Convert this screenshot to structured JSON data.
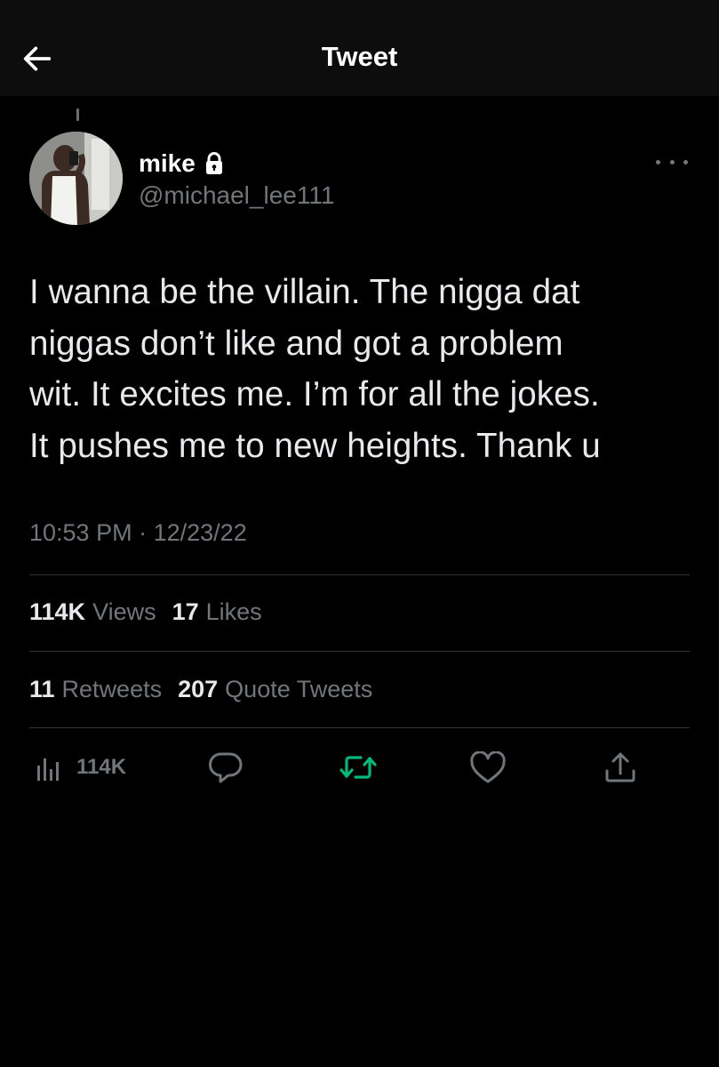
{
  "header": {
    "title": "Tweet",
    "back_icon": "arrow-left-icon"
  },
  "author": {
    "display_name": "mike",
    "handle": "@michael_lee111",
    "protected_icon": "lock-icon"
  },
  "tweet": {
    "lines": [
      "I wanna be the villain. The nigga dat",
      "niggas don’t like and got a problem",
      "wit. It excites me. I’m for all the jokes.",
      "It pushes me to new heights. Thank u"
    ],
    "time": "10:53 PM",
    "separator": "·",
    "date": "12/23/22"
  },
  "stats": {
    "views_count": "114K",
    "views_label": "Views",
    "likes_count": "17",
    "likes_label": "Likes",
    "retweets_count": "11",
    "retweets_label": "Retweets",
    "quotes_count": "207",
    "quotes_label": "Quote Tweets"
  },
  "actions": {
    "views_count": "114K",
    "icons": [
      "analytics-icon",
      "reply-icon",
      "retweet-icon",
      "like-icon",
      "share-icon"
    ]
  },
  "colors": {
    "background": "#000000",
    "header_background": "#0d0d0d",
    "text_primary": "#e7e9ea",
    "text_secondary": "#71767b",
    "divider": "#2f3336",
    "retweet_active": "#00ba7c"
  }
}
